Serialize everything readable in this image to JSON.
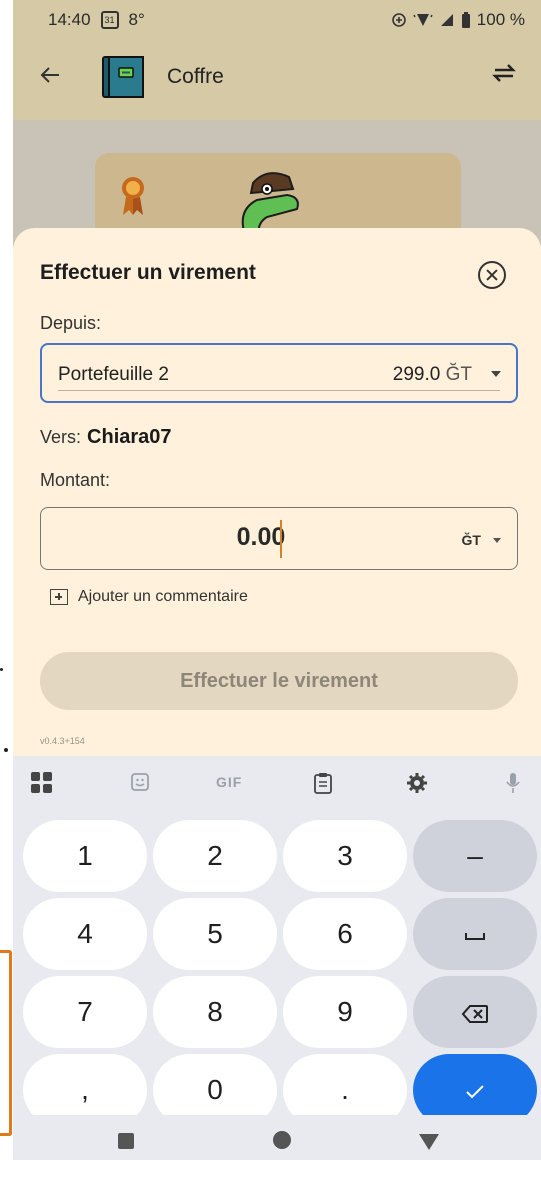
{
  "status_bar": {
    "time": "14:40",
    "calendar_day": "31",
    "temperature": "8°",
    "battery": "100 %"
  },
  "app_bar": {
    "title": "Coffre",
    "back_icon": "arrow-left-icon",
    "swap_icon": "swap-horizontal-icon"
  },
  "transfer_sheet": {
    "title": "Effectuer un virement",
    "from_label": "Depuis:",
    "from_wallet": "Portefeuille 2",
    "from_balance": "299.0",
    "from_unit": "ĞT",
    "to_label": "Vers:",
    "to_name": "Chiara07",
    "amount_label": "Montant:",
    "amount_value": "0.00",
    "amount_unit": "ĞT",
    "add_comment": "Ajouter un commentaire",
    "submit": "Effectuer le virement",
    "version": "v0.4.3+154"
  },
  "keyboard": {
    "toolbar": {
      "gif": "GIF",
      "icons": [
        "apps-grid-icon",
        "sticker-icon",
        "clipboard-icon",
        "settings-icon",
        "mic-icon"
      ]
    },
    "keys": {
      "k1": "1",
      "k2": "2",
      "k3": "3",
      "minus": "–",
      "k4": "4",
      "k5": "5",
      "k6": "6",
      "k7": "7",
      "k8": "8",
      "k9": "9",
      "comma": ",",
      "k0": "0",
      "dot": ".",
      "space_icon": "space-icon",
      "backspace_icon": "backspace-icon",
      "done_icon": "check-icon"
    }
  },
  "colors": {
    "app_bar": "#d6c9a6",
    "sheet": "#fff1dc",
    "select_border": "#4a74c8",
    "cursor": "#d1822a",
    "keyboard_accent": "#1a73e8",
    "highlight_outline": "#e07a1a"
  }
}
